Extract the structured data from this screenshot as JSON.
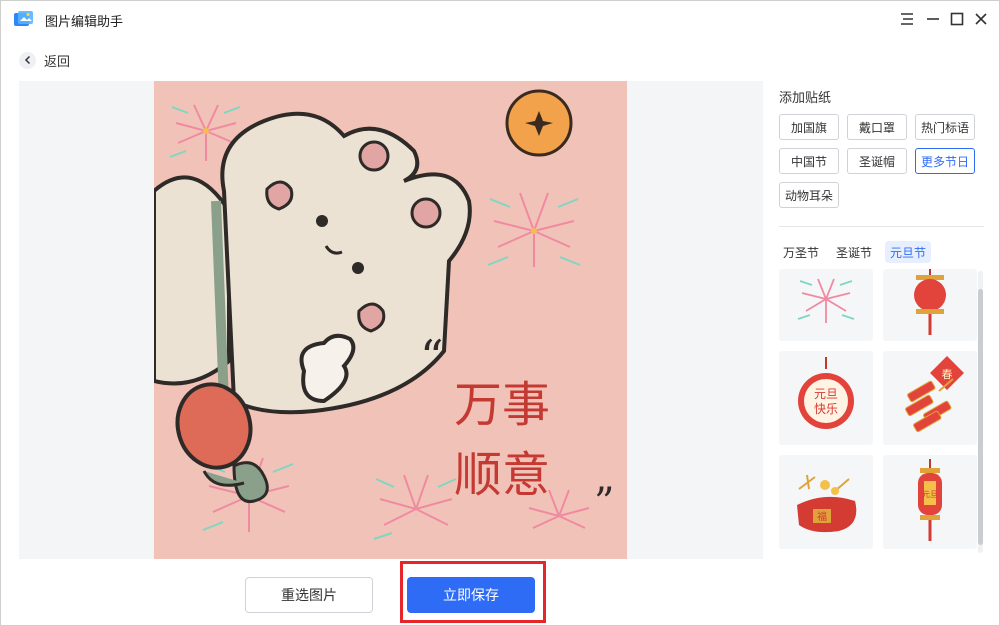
{
  "app": {
    "title": "图片编辑助手"
  },
  "window_controls": {
    "menu": "menu-icon",
    "minimize": "minimize-icon",
    "maximize": "maximize-icon",
    "close": "close-icon"
  },
  "nav": {
    "back_label": "返回"
  },
  "canvas": {
    "caption_line1": "万事",
    "caption_line2": "顺意",
    "quote_open": "“",
    "quote_close": "”"
  },
  "panel": {
    "title": "添加贴纸",
    "categories": [
      "加国旗",
      "戴口罩",
      "热门标语",
      "中国节",
      "圣诞帽",
      "更多节日",
      "动物耳朵"
    ],
    "active_category": "更多节日",
    "subtabs": [
      "万圣节",
      "圣诞节",
      "元旦节"
    ],
    "active_subtab": "元旦节",
    "stickers": [
      "fireworks-sticker",
      "lantern-sticker",
      "yuandan-medallion-sticker",
      "firecracker-sticker",
      "fortune-bag-sticker",
      "yuandan-lantern-sticker"
    ],
    "sticker_texts": {
      "medallion_line1": "元旦",
      "medallion_line2": "快乐",
      "bag": "福",
      "lantern": "元旦",
      "firecracker": "春"
    }
  },
  "footer": {
    "reselect_label": "重选图片",
    "save_label": "立即保存"
  },
  "colors": {
    "accent": "#2f6cf6",
    "highlight": "#e6262b",
    "canvas_bg": "#f1c3b8"
  }
}
